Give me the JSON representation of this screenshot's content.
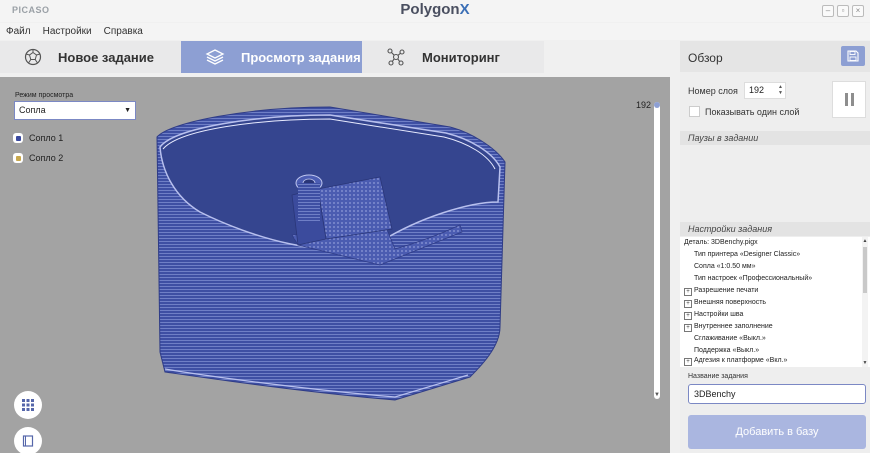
{
  "titlebar": {
    "brand": "PICASO",
    "app_title": "Polygon",
    "app_title_mark": "X"
  },
  "menu": [
    "Файл",
    "Настройки",
    "Справка"
  ],
  "tabs": [
    {
      "label": "Новое задание",
      "icon": "ball-icon"
    },
    {
      "label": "Просмотр задания",
      "icon": "layers-icon",
      "active": true
    },
    {
      "label": "Мониторинг",
      "icon": "network-icon"
    }
  ],
  "viewport": {
    "view_mode_label": "Режим просмотра",
    "view_mode_value": "Сопла",
    "nozzles": [
      {
        "label": "Сопло 1",
        "color": "#3a4aa0"
      },
      {
        "label": "Сопло 2",
        "color": "#c8a84e"
      }
    ],
    "layer_slider_value": "192",
    "model_color": "#3e4fa3"
  },
  "panel": {
    "title": "Обзор",
    "layer_label": "Номер слоя",
    "layer_value": "192",
    "single_layer_label": "Показывать один слой",
    "pauses_header": "Паузы в задании",
    "settings_header": "Настройки задания",
    "details": [
      {
        "text": "Деталь: 3DBenchy.pigx",
        "indent": 0,
        "expandable": false
      },
      {
        "text": "Тип принтера «Designer Classic»",
        "indent": 1,
        "expandable": false
      },
      {
        "text": "Сопла «1:0.50 мм»",
        "indent": 1,
        "expandable": false
      },
      {
        "text": "Тип настроек «Профессиональный»",
        "indent": 1,
        "expandable": false
      },
      {
        "text": "Разрешение печати",
        "indent": 0,
        "expandable": true
      },
      {
        "text": "Внешняя поверхность",
        "indent": 0,
        "expandable": true
      },
      {
        "text": "Настройки шва",
        "indent": 0,
        "expandable": true
      },
      {
        "text": "Внутреннее заполнение",
        "indent": 0,
        "expandable": true
      },
      {
        "text": "Сглаживание «Выкл.»",
        "indent": 1,
        "expandable": false
      },
      {
        "text": "Поддержка «Выкл.»",
        "indent": 1,
        "expandable": false
      },
      {
        "text": "Адгезия к платформе «Вкл.»",
        "indent": 0,
        "expandable": true
      }
    ],
    "name_label": "Название задания",
    "name_value": "3DBenchy",
    "add_button": "Добавить в базу"
  },
  "colors": {
    "accent": "#8d9fd3",
    "viewport_bg": "#a3a3a3"
  }
}
